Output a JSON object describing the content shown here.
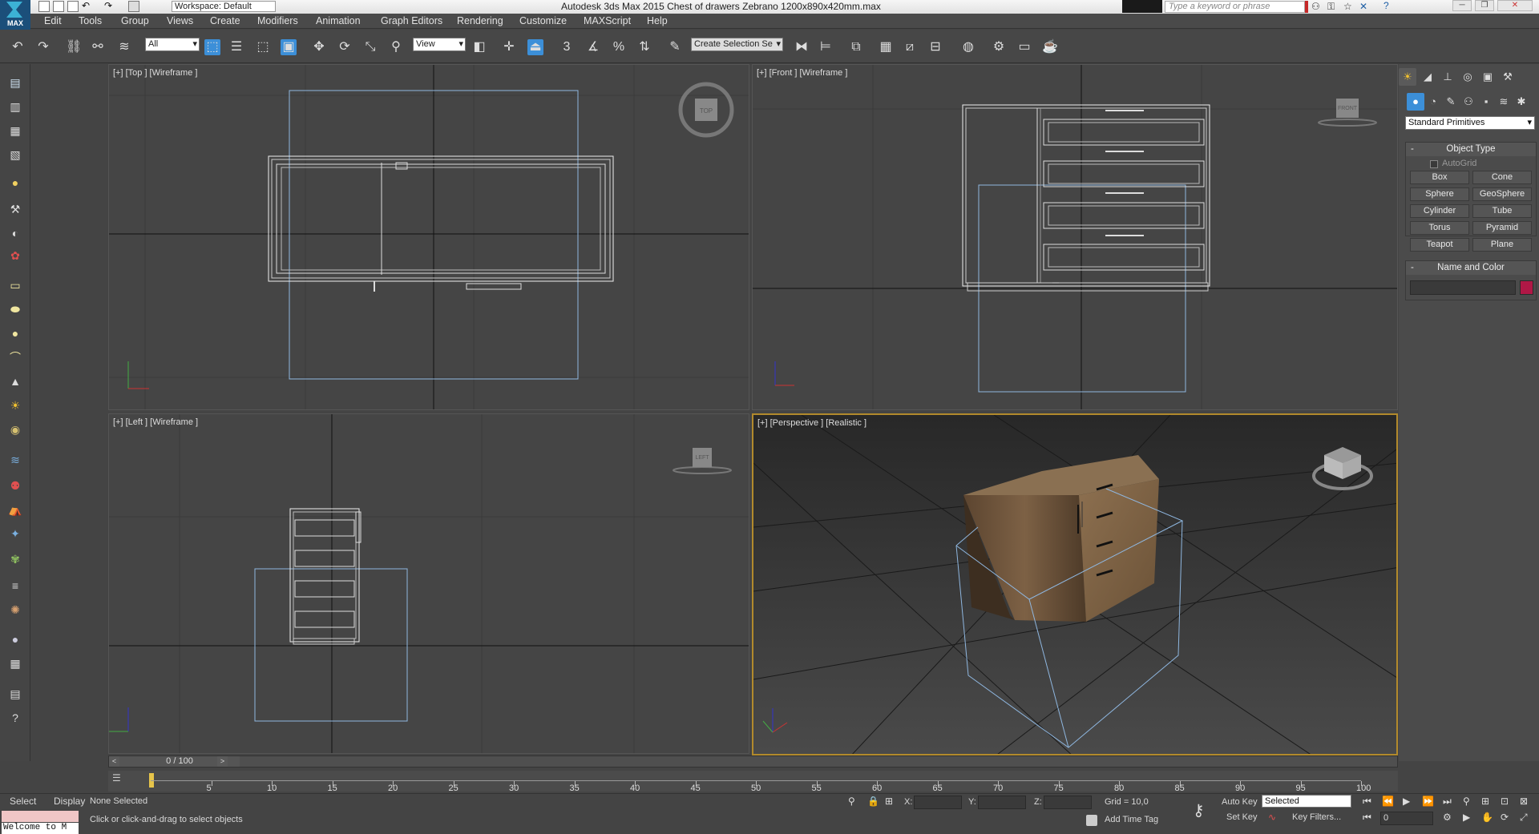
{
  "titlebar": {
    "logo": "MAX",
    "workspace": "Workspace: Default",
    "title": "Autodesk 3ds Max  2015     Chest of drawers Zebrano 1200x890x420mm.max",
    "search_placeholder": "Type a keyword or phrase"
  },
  "menus": [
    "Edit",
    "Tools",
    "Group",
    "Views",
    "Create",
    "Modifiers",
    "Animation",
    "Graph Editors",
    "Rendering",
    "Customize",
    "MAXScript",
    "Help"
  ],
  "toolbar": {
    "filter": "All",
    "refcoord": "View",
    "selection_set": "Create Selection Se",
    "snap_label": "3",
    "percent_label": "%"
  },
  "viewports": {
    "top": "[+] [Top ] [Wireframe ]",
    "front": "[+] [Front ] [Wireframe ]",
    "left": "[+] [Left ] [Wireframe ]",
    "perspective": "[+] [Perspective ] [Realistic ]",
    "cube_top": "TOP",
    "cube_front": "FRONT",
    "cube_left": "LEFT"
  },
  "command_panel": {
    "category": "Standard Primitives",
    "object_type_title": "Object Type",
    "autogrid": "AutoGrid",
    "buttons": [
      "Box",
      "Cone",
      "Sphere",
      "GeoSphere",
      "Cylinder",
      "Tube",
      "Torus",
      "Pyramid",
      "Teapot",
      "Plane"
    ],
    "name_color_title": "Name and Color",
    "color": "#b01846"
  },
  "timeline": {
    "frame": "0 / 100",
    "ticks": [
      "5",
      "10",
      "15",
      "20",
      "25",
      "30",
      "35",
      "40",
      "45",
      "50",
      "55",
      "60",
      "65",
      "70",
      "75",
      "80",
      "85",
      "90",
      "95",
      "100"
    ]
  },
  "status": {
    "mode_select": "Select",
    "mode_display": "Display",
    "listener": "Welcome to M",
    "selected": "None Selected",
    "prompt": "Click or click-and-drag to select objects",
    "x_label": "X:",
    "y_label": "Y:",
    "z_label": "Z:",
    "grid": "Grid = 10,0",
    "add_time_tag": "Add Time Tag",
    "auto_key": "Auto Key",
    "set_key": "Set Key",
    "key_mode": "Selected",
    "key_filters": "Key Filters...",
    "frame_field": "0"
  },
  "colors": {
    "accent": "#3c8fd8",
    "active_viewport": "#b28a2c",
    "selection": "#8fb7e0",
    "wood": "#6b5237"
  }
}
